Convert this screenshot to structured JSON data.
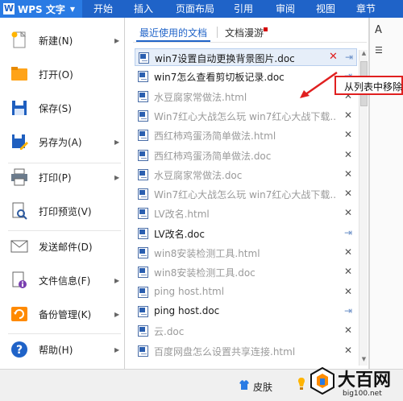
{
  "app": {
    "title": "WPS 文字"
  },
  "ribbon": {
    "tabs": [
      "开始",
      "插入",
      "页面布局",
      "引用",
      "审阅",
      "视图",
      "章节"
    ]
  },
  "menu": {
    "items": [
      {
        "label": "新建(N)",
        "icon": "new-document-icon",
        "has_submenu": true
      },
      {
        "label": "打开(O)",
        "icon": "open-folder-icon",
        "has_submenu": false
      },
      {
        "label": "保存(S)",
        "icon": "save-floppy-icon",
        "has_submenu": false
      },
      {
        "label": "另存为(A)",
        "icon": "save-as-icon",
        "has_submenu": true
      },
      {
        "label": "打印(P)",
        "icon": "printer-icon",
        "has_submenu": true
      },
      {
        "label": "打印预览(V)",
        "icon": "print-preview-icon",
        "has_submenu": false
      },
      {
        "label": "发送邮件(D)",
        "icon": "mail-icon",
        "has_submenu": false
      },
      {
        "label": "文件信息(F)",
        "icon": "file-info-icon",
        "has_submenu": true
      },
      {
        "label": "备份管理(K)",
        "icon": "backup-icon",
        "has_submenu": true
      },
      {
        "label": "帮助(H)",
        "icon": "help-icon",
        "has_submenu": true
      }
    ]
  },
  "panel": {
    "tabs": {
      "recent": "最近使用的文档",
      "roaming": "文档漫游"
    },
    "documents": [
      {
        "name": "win7设置自动更换背景图片.doc",
        "exists": true,
        "action": "pin",
        "active": true
      },
      {
        "name": "win7怎么查看剪切板记录.doc",
        "exists": true,
        "action": "pin",
        "active": false
      },
      {
        "name": "水豆腐家常做法.html",
        "exists": false,
        "action": "delete",
        "active": false
      },
      {
        "name": "Win7红心大战怎么玩 win7红心大战下载...",
        "exists": false,
        "action": "delete",
        "active": false
      },
      {
        "name": "西红柿鸡蛋汤简单做法.html",
        "exists": false,
        "action": "delete",
        "active": false
      },
      {
        "name": "西红柿鸡蛋汤简单做法.doc",
        "exists": false,
        "action": "delete",
        "active": false
      },
      {
        "name": "水豆腐家常做法.doc",
        "exists": false,
        "action": "delete",
        "active": false
      },
      {
        "name": "Win7红心大战怎么玩 win7红心大战下载...",
        "exists": false,
        "action": "delete",
        "active": false
      },
      {
        "name": "LV改名.html",
        "exists": false,
        "action": "delete",
        "active": false
      },
      {
        "name": "LV改名.doc",
        "exists": true,
        "action": "pin",
        "active": false
      },
      {
        "name": "win8安装检测工具.html",
        "exists": false,
        "action": "delete",
        "active": false
      },
      {
        "name": "win8安装检测工具.doc",
        "exists": false,
        "action": "delete",
        "active": false
      },
      {
        "name": "ping host.html",
        "exists": false,
        "action": "delete",
        "active": false
      },
      {
        "name": "ping host.doc",
        "exists": true,
        "action": "pin",
        "active": false
      },
      {
        "name": "云.doc",
        "exists": false,
        "action": "delete",
        "active": false
      },
      {
        "name": "百度网盘怎么设置共享连接.html",
        "exists": false,
        "action": "delete",
        "active": false
      }
    ]
  },
  "tooltip": {
    "text": "从列表中移除"
  },
  "bottom": {
    "skin_label": "皮肤"
  },
  "watermark": {
    "title": "大百网",
    "url": "big100.net"
  },
  "colors": {
    "titlebar": "#1f63c8",
    "wps_menu": "#2a7be4",
    "accent": "#1f63c8",
    "annotation_red": "#e02020",
    "missing_text": "#9a9a9a"
  }
}
